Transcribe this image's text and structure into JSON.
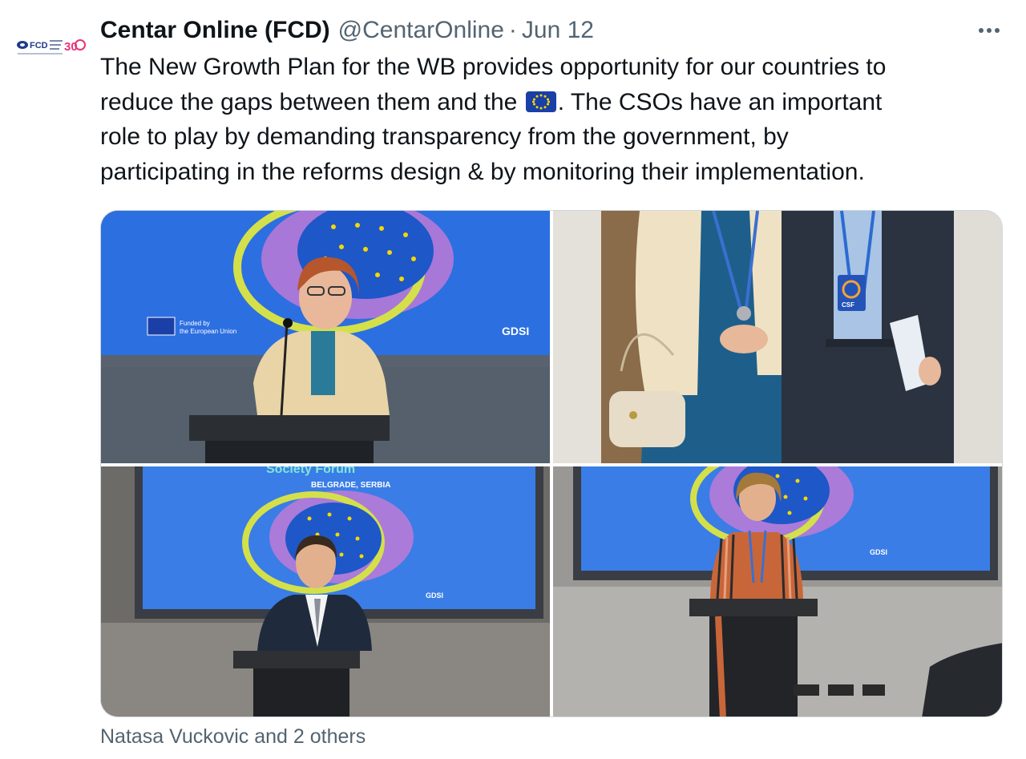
{
  "tweet": {
    "author_name": "Centar Online (FCD)",
    "handle": "@CentarOnline",
    "separator": "·",
    "date": "Jun 12",
    "more_icon": "more-horizontal-icon",
    "text_lines": [
      "The New Growth Plan for the WB provides opportunity for our countries to",
      "reduce the gaps between them and the",
      ". The CSOs have an important",
      "role to play by demanding transparency from the government, by",
      "participating in the reforms design & by monitoring their implementation."
    ],
    "flag_icon": "eu-flag-icon",
    "tagged_users": "Natasa Vuckovic and 2 others"
  },
  "avatar": {
    "logo_text": "FCD",
    "badge_text": "30"
  },
  "colors": {
    "text": "#0f1419",
    "secondary": "#536471",
    "eu_blue": "#1a3fa6",
    "eu_star": "#f5d800",
    "screen_blue": "#2c6fe0"
  },
  "photos": [
    {
      "name": "speaker-woman-podium",
      "banner_funded": "Funded by",
      "banner_funded2": "the European Union",
      "banner_logo": "GDSI"
    },
    {
      "name": "two-people-standing",
      "badge_text": "CSF"
    },
    {
      "name": "speaker-man-podium",
      "banner_title": "Society Forum",
      "banner_sub": "BELGRADE, SERBIA",
      "banner_logo": "GDSI"
    },
    {
      "name": "speaker-woman-striped",
      "banner_logo": "GDSI"
    }
  ]
}
